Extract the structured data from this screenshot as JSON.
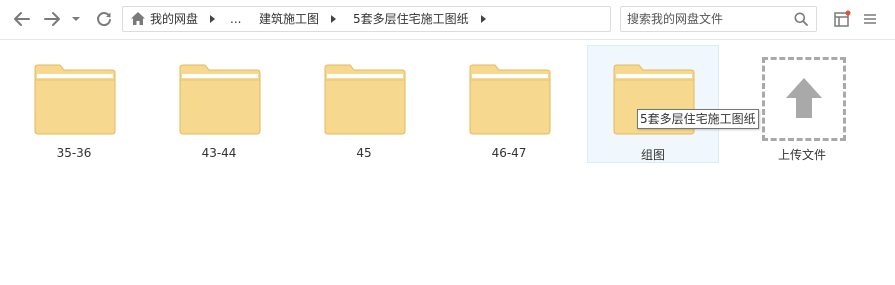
{
  "toolbar": {
    "back_icon": "arrow-left-icon",
    "forward_icon": "arrow-right-icon",
    "history_icon": "chevron-down-icon",
    "refresh_icon": "refresh-icon",
    "home_icon": "home-icon"
  },
  "breadcrumb": {
    "items": [
      "我的网盘",
      "...",
      "建筑施工图",
      "5套多层住宅施工图纸"
    ]
  },
  "search": {
    "placeholder": "搜索我的网盘文件",
    "value": ""
  },
  "window_controls": [
    "layout-icon",
    "menu-icon"
  ],
  "colors": {
    "folder_fill": "#f6d98f",
    "folder_edge": "#e3b95e",
    "selected_bg": "#f1f8fd",
    "notify_dot": "#e84c3d"
  },
  "folders": [
    {
      "name": "35-36"
    },
    {
      "name": "43-44"
    },
    {
      "name": "45"
    },
    {
      "name": "46-47"
    },
    {
      "name": "组图",
      "selected": true
    }
  ],
  "upload": {
    "label": "上传文件",
    "icon": "upload-arrow-icon"
  },
  "tooltip": {
    "text": "5套多层住宅施工图纸"
  }
}
